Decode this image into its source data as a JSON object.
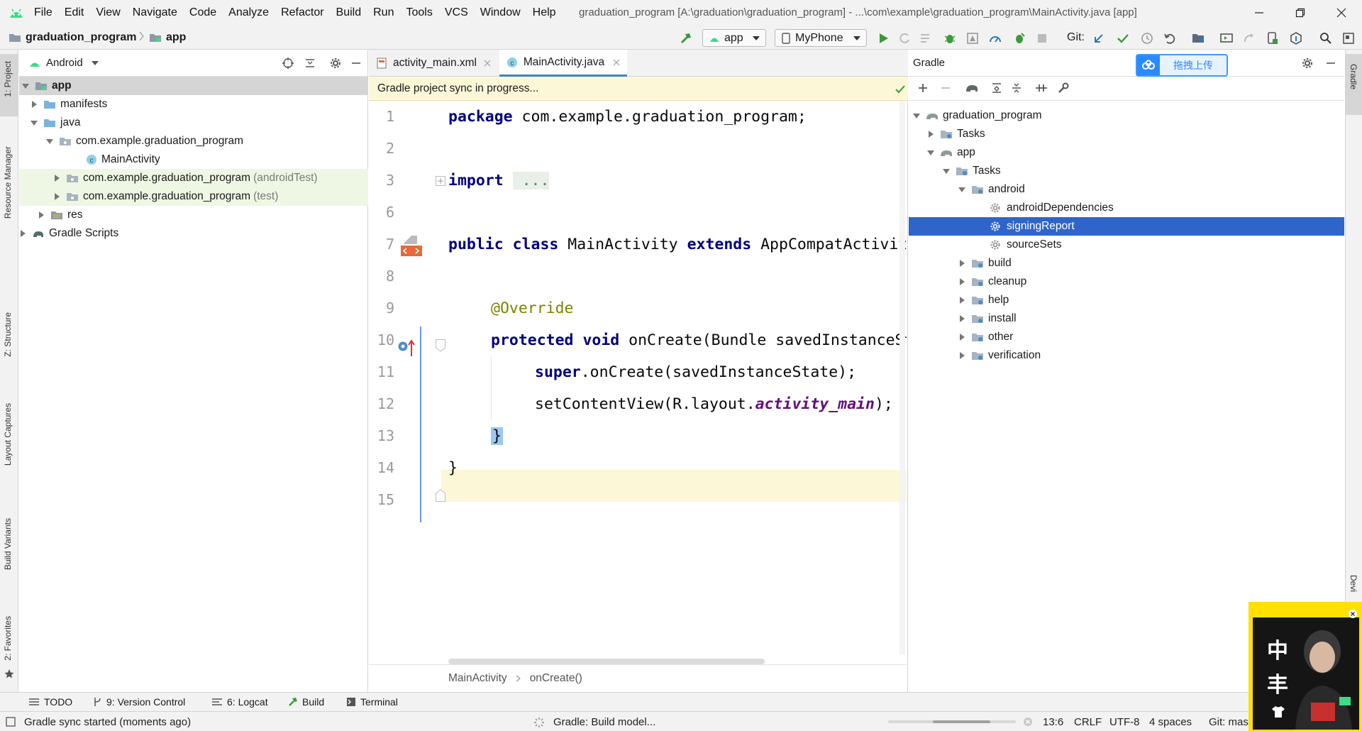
{
  "menubar": {
    "items": [
      "File",
      "Edit",
      "View",
      "Navigate",
      "Code",
      "Analyze",
      "Refactor",
      "Build",
      "Run",
      "Tools",
      "VCS",
      "Window",
      "Help"
    ],
    "window_title": "graduation_program [A:\\graduation\\graduation_program] - ...\\com\\example\\graduation_program\\MainActivity.java [app]"
  },
  "navbar": {
    "project": "graduation_program",
    "module": "app",
    "run_config": "app",
    "device": "MyPhone",
    "git_label": "Git:"
  },
  "left_strip": {
    "project": "1: Project",
    "resource_manager": "Resource Manager",
    "structure": "Z: Structure",
    "layout_captures": "Layout Captures",
    "build_variants": "Build Variants",
    "favorites": "2: Favorites"
  },
  "right_strip": {
    "gradle": "Gradle",
    "device": "Devi"
  },
  "project_panel": {
    "view_selector": "Android",
    "tree": [
      {
        "label": "app",
        "suffix": ""
      },
      {
        "label": "manifests",
        "suffix": ""
      },
      {
        "label": "java",
        "suffix": ""
      },
      {
        "label": "com.example.graduation_program",
        "suffix": ""
      },
      {
        "label": "MainActivity",
        "suffix": ""
      },
      {
        "label": "com.example.graduation_program",
        "suffix": "(androidTest)"
      },
      {
        "label": "com.example.graduation_program",
        "suffix": "(test)"
      },
      {
        "label": "res",
        "suffix": ""
      },
      {
        "label": "Gradle Scripts",
        "suffix": ""
      }
    ]
  },
  "editor": {
    "tabs": [
      "activity_main.xml",
      "MainActivity.java"
    ],
    "active_tab": "MainActivity.java",
    "notice": "Gradle project sync in progress...",
    "line_numbers": [
      "1",
      "2",
      "3",
      "6",
      "7",
      "8",
      "9",
      "10",
      "11",
      "12",
      "13",
      "14",
      "15"
    ],
    "code": {
      "l1_kw": "package",
      "l1_rest": " com.example.graduation_program;",
      "l3_kw": "import",
      "l3_fold": " ...",
      "l7_kw1": "public class",
      "l7_name": " MainActivity ",
      "l7_kw2": "extends",
      "l7_rest": " AppCompatActivity {",
      "l9_ann": "@Override",
      "l10_kw": "protected void",
      "l10_rest": " onCreate(Bundle savedInstanceState) {",
      "l11_kw": "super",
      "l11_rest": ".onCreate(savedInstanceState);",
      "l12_pre": "setContentView(R.layout.",
      "l12_ital": "activity_main",
      "l12_post": ");",
      "l13": "}",
      "l14": "}"
    },
    "breadcrumb": [
      "MainActivity",
      "onCreate()"
    ]
  },
  "gradle_panel": {
    "title": "Gradle",
    "tree": [
      {
        "label": "graduation_program"
      },
      {
        "label": "Tasks"
      },
      {
        "label": "app"
      },
      {
        "label": "Tasks"
      },
      {
        "label": "android"
      },
      {
        "label": "androidDependencies"
      },
      {
        "label": "signingReport"
      },
      {
        "label": "sourceSets"
      },
      {
        "label": "build"
      },
      {
        "label": "cleanup"
      },
      {
        "label": "help"
      },
      {
        "label": "install"
      },
      {
        "label": "other"
      },
      {
        "label": "verification"
      }
    ],
    "selected": "signingReport"
  },
  "baidu_widget": {
    "label": "拖拽上传"
  },
  "sticker": {
    "chars": [
      "中",
      "丰"
    ]
  },
  "bottom_tools": [
    {
      "label": "TODO"
    },
    {
      "label": "9: Version Control"
    },
    {
      "label": "6: Logcat"
    },
    {
      "label": "Build"
    },
    {
      "label": "Terminal"
    }
  ],
  "status": {
    "message": "Gradle sync started (moments ago)",
    "progress": "Gradle: Build model...",
    "position": "13:6",
    "line_sep": "CRLF",
    "encoding": "UTF-8",
    "indent": "4 spaces",
    "git": "Git: master"
  },
  "colors": {
    "selection": "#2f65ca",
    "keyword": "#000080",
    "annotation": "#808000",
    "notice_bg": "#fcf7d7",
    "android_green": "#3ddc84"
  }
}
